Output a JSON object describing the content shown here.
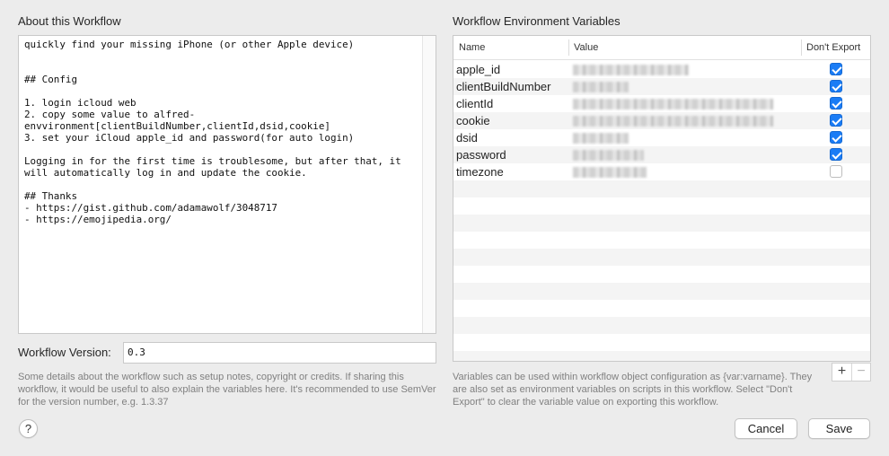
{
  "about": {
    "title": "About this Workflow",
    "notes": "quickly find your missing iPhone (or other Apple device)\n\n\n## Config\n\n1. login icloud web\n2. copy some value to alfred-envvironment[clientBuildNumber,clientId,dsid,cookie]\n3. set your iCloud apple_id and password(for auto login)\n\nLogging in for the first time is troublesome, but after that, it will automatically log in and update the cookie.\n\n## Thanks\n- https://gist.github.com/adamawolf/3048717\n- https://emojipedia.org/",
    "version_label": "Workflow Version:",
    "version_value": "0.3",
    "help": "Some details about the workflow such as setup notes, copyright or credits. If sharing this workflow, it would be useful to also explain the variables here. It's recommended to use SemVer for the version number, e.g. 1.3.37"
  },
  "env": {
    "title": "Workflow Environment Variables",
    "columns": {
      "name": "Name",
      "value": "Value",
      "export": "Don't Export"
    },
    "rows": [
      {
        "name": "apple_id",
        "dont_export": true,
        "value_fill": 0.52
      },
      {
        "name": "clientBuildNumber",
        "dont_export": true,
        "value_fill": 0.25
      },
      {
        "name": "clientId",
        "dont_export": true,
        "value_fill": 0.9
      },
      {
        "name": "cookie",
        "dont_export": true,
        "value_fill": 0.9
      },
      {
        "name": "dsid",
        "dont_export": true,
        "value_fill": 0.25
      },
      {
        "name": "password",
        "dont_export": true,
        "value_fill": 0.32
      },
      {
        "name": "timezone",
        "dont_export": false,
        "value_fill": 0.33
      }
    ],
    "help": "Variables can be used within workflow object configuration as {var:varname}. They are also set as environment variables on scripts in this workflow. Select \"Don't Export\" to clear the variable value on exporting this workflow.",
    "add_symbol": "+",
    "remove_symbol": "−"
  },
  "footer": {
    "help_symbol": "?",
    "cancel": "Cancel",
    "save": "Save"
  },
  "colors": {
    "accent": "#1a7cf5",
    "background": "#ececec"
  }
}
